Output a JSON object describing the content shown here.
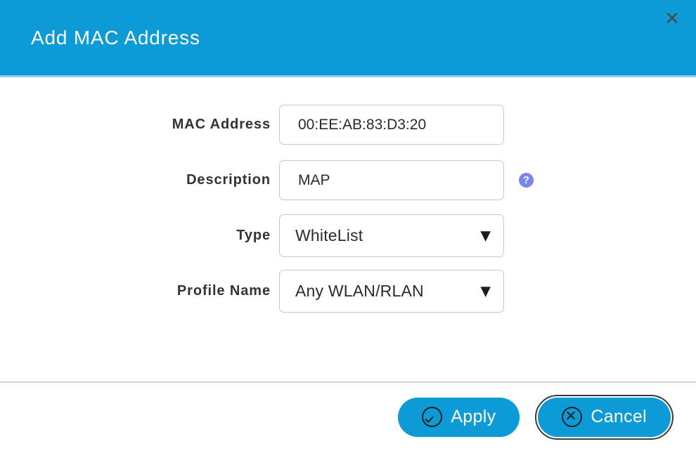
{
  "dialog": {
    "title": "Add MAC Address",
    "close_icon": "close-icon",
    "close_glyph": "✕",
    "header_color": "#0d9bd7"
  },
  "form": {
    "fields": [
      {
        "label": "MAC Address",
        "type": "text",
        "value": "00:EE:AB:83:D3:20",
        "placeholder": "",
        "help": false
      },
      {
        "label": "Description",
        "type": "text",
        "value": "MAP",
        "placeholder": "",
        "help": true,
        "help_glyph": "?",
        "help_color": "#7b86ec"
      },
      {
        "label": "Type",
        "type": "select",
        "value": "WhiteList",
        "caret_glyph": "▼",
        "help": false
      },
      {
        "label": "Profile Name",
        "type": "select",
        "value": "Any WLAN/RLAN",
        "caret_glyph": "▼",
        "help": false
      }
    ]
  },
  "footer": {
    "apply_label": "Apply",
    "apply_icon": "check-circle-icon",
    "cancel_label": "Cancel",
    "cancel_icon": "x-circle-icon",
    "button_color": "#0d9bd7"
  }
}
